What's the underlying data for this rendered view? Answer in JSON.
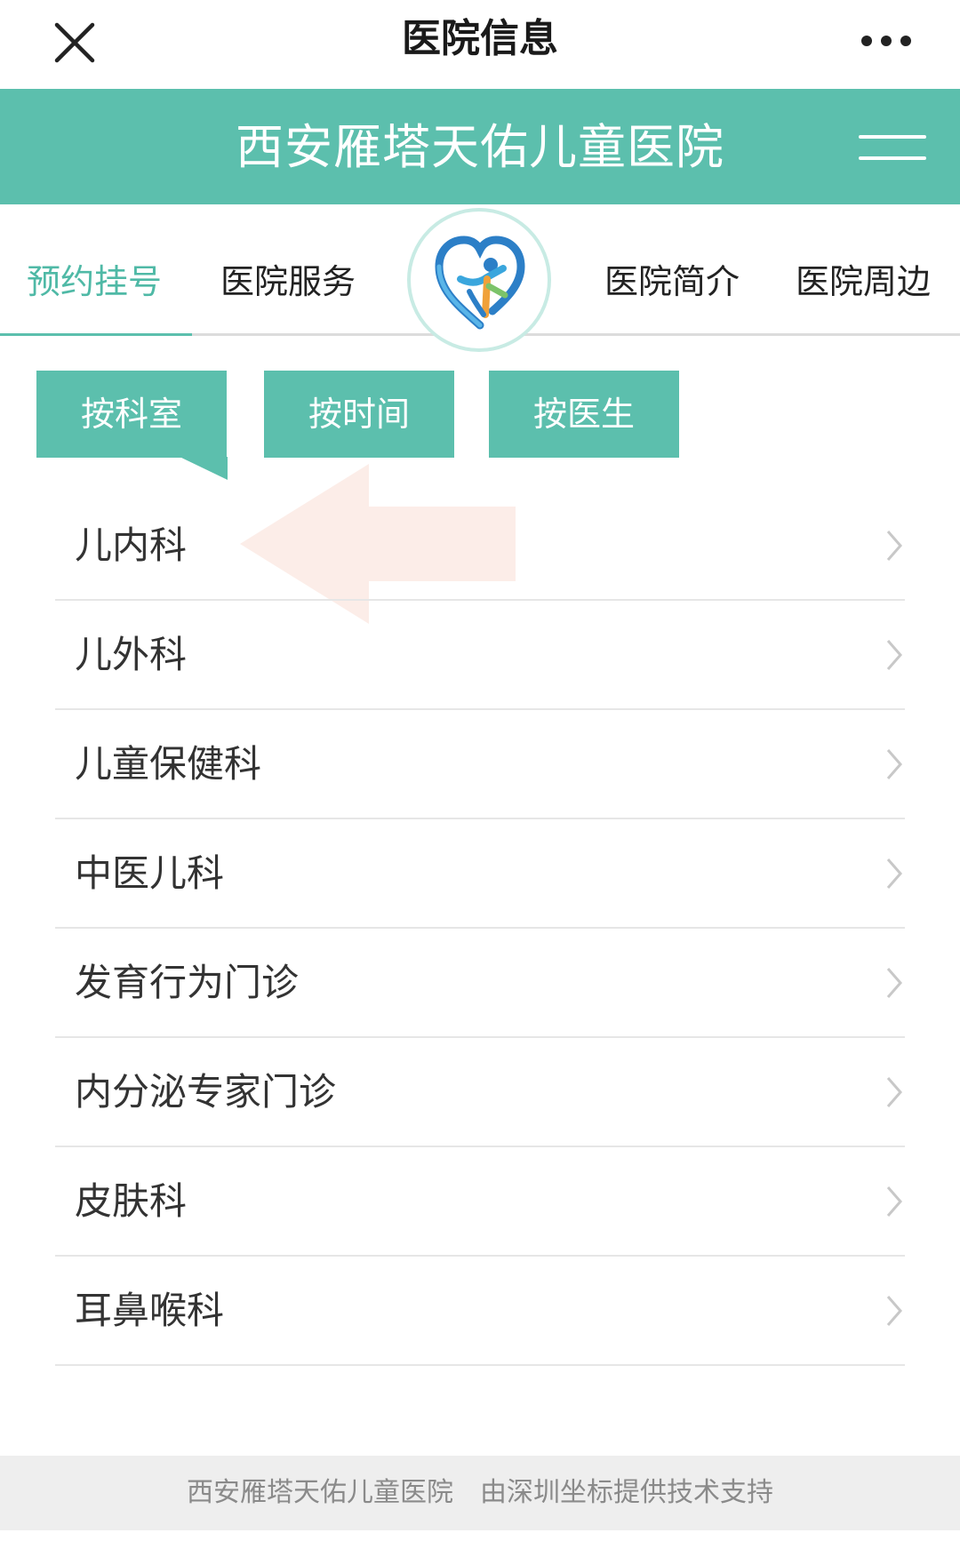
{
  "topbar": {
    "title": "医院信息"
  },
  "header": {
    "hospital_name": "西安雁塔天佑儿童医院"
  },
  "nav": {
    "tabs": [
      {
        "label": "预约挂号",
        "active": true
      },
      {
        "label": "医院服务",
        "active": false
      },
      {
        "label": "医院简介",
        "active": false
      },
      {
        "label": "医院周边",
        "active": false
      }
    ]
  },
  "filters": [
    {
      "label": "按科室",
      "active": true
    },
    {
      "label": "按时间",
      "active": false
    },
    {
      "label": "按医生",
      "active": false
    }
  ],
  "departments": [
    {
      "label": "儿内科"
    },
    {
      "label": "儿外科"
    },
    {
      "label": "儿童保健科"
    },
    {
      "label": "中医儿科"
    },
    {
      "label": "发育行为门诊"
    },
    {
      "label": "内分泌专家门诊"
    },
    {
      "label": "皮肤科"
    },
    {
      "label": "耳鼻喉科"
    }
  ],
  "footer": {
    "hospital": "西安雁塔天佑儿童医院",
    "support": "由深圳坐标提供技术支持"
  },
  "colors": {
    "accent": "#5cbfad",
    "active_text": "#4fb9a6"
  },
  "icons": [
    "close-icon",
    "more-icon",
    "menu-icon",
    "hospital-logo",
    "chevron-right-icon",
    "arrow-left-icon"
  ]
}
